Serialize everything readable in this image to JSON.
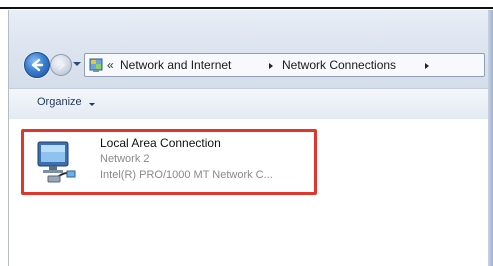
{
  "address_bar": {
    "overflow_chevrons": "«",
    "breadcrumbs": [
      "Network and Internet",
      "Network Connections"
    ]
  },
  "toolbar": {
    "organize_label": "Organize"
  },
  "connection": {
    "name": "Local Area Connection",
    "network": "Network  2",
    "adapter": "Intel(R) PRO/1000 MT Network C..."
  },
  "highlight_color": "#e0362b",
  "icons": [
    "back-arrow-icon",
    "forward-arrow-icon",
    "nav-history-dropdown-icon",
    "control-panel-icon",
    "breadcrumb-separator-icon",
    "organize-dropdown-icon",
    "network-adapter-icon"
  ]
}
